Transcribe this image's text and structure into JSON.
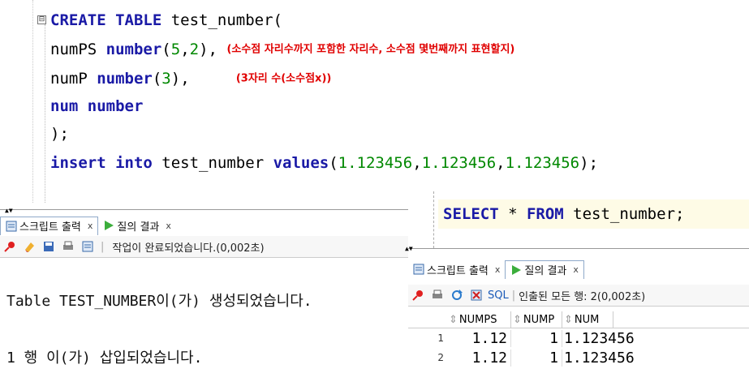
{
  "editor": {
    "fold_symbol": "⊟",
    "line1": {
      "kw": "CREATE TABLE",
      "rest": " test_number("
    },
    "line2": {
      "col": "numPS ",
      "type": "number",
      "args_open": "(",
      "a1": "5",
      "comma": ",",
      "a2": "2",
      "close": "),",
      "comment": "(소수점 자리수까지 포함한 자리수, 소수점 몇번째까지 표현할지)"
    },
    "line3": {
      "col": "numP ",
      "type": "number",
      "args_open": "(",
      "a1": "3",
      "close": "),",
      "comment": "(3자리 수(소수점x))"
    },
    "line4": {
      "col": "num ",
      "type": "number"
    },
    "line5": ");",
    "line6": {
      "kw1": "insert",
      "kw2": "into",
      "table": " test_number ",
      "kw3": "values",
      "open": "(",
      "v1": "1.123456",
      "v2": "1.123456",
      "v3": "1.123456",
      "close": ");"
    }
  },
  "select_stmt": {
    "kw1": "SELECT",
    "star": " * ",
    "kw2": "FROM",
    "rest": " test_number;"
  },
  "left_panel": {
    "tab1": "스크립트 출력",
    "tab2": "질의 결과",
    "close": "x",
    "status": "작업이 완료되었습니다.(0,002초)",
    "output1": "Table TEST_NUMBER이(가) 생성되었습니다.",
    "output2": "1 행 이(가) 삽입되었습니다."
  },
  "right_panel": {
    "tab1": "스크립트 출력",
    "tab2": "질의 결과",
    "close": "x",
    "sql": "SQL",
    "status": "인출된 모든 행: 2(0,002초)",
    "columns": [
      "NUMPS",
      "NUMP",
      "NUM"
    ],
    "rows": [
      {
        "rn": "1",
        "numps": "1.12",
        "nump": "1",
        "num": "1.123456"
      },
      {
        "rn": "2",
        "numps": "1.12",
        "nump": "1",
        "num": "1.123456"
      }
    ]
  },
  "colors": {
    "keyword": "#1a1aa6",
    "number": "#008800",
    "comment": "#e00000",
    "select_highlight": "#fefbe6"
  }
}
